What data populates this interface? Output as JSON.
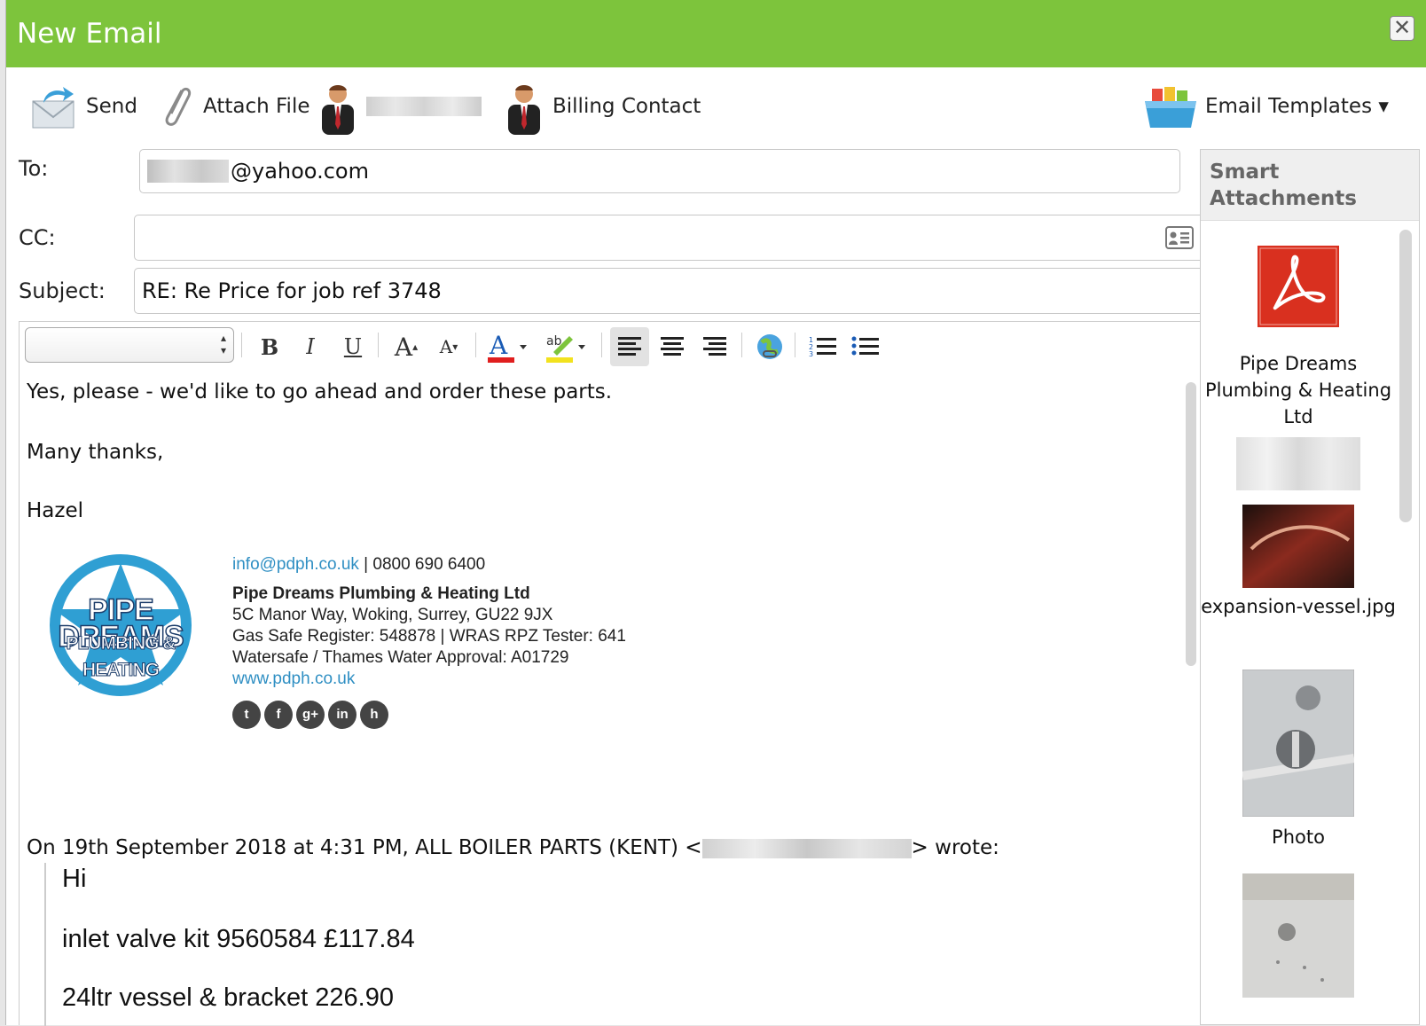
{
  "window": {
    "title": "New Email",
    "close_glyph": "✕"
  },
  "toolbar": {
    "send_label": "Send",
    "attach_label": "Attach File",
    "billing_label": "Billing Contact",
    "templates_label": "Email Templates ▾"
  },
  "fields": {
    "to_label": "To:",
    "to_value_visible": "@yahoo.com",
    "cc_label": "CC:",
    "cc_value": "",
    "subject_label": "Subject:",
    "subject_value": "RE: Re Price for job ref 3748"
  },
  "editor": {
    "line1": "Yes, please - we'd like to go ahead and order these parts.",
    "line2": "Many thanks,",
    "line3": "Hazel",
    "signature": {
      "logo_line1": "PIPE DREAMS",
      "logo_line2": "PLUMBING & HEATING",
      "email": "info@pdph.co.uk",
      "phone": " | 0800 690 6400",
      "company": "Pipe Dreams Plumbing & Heating Ltd",
      "address": "5C Manor Way, Woking, Surrey, GU22 9JX",
      "register": "Gas Safe Register: 548878 | WRAS RPZ Tester: 641",
      "approval": "Watersafe / Thames Water Approval: A01729",
      "website": "www.pdph.co.uk"
    },
    "quote_intro_start": "On 19th September 2018 at 4:31 PM, ALL BOILER PARTS (KENT) <",
    "quote_intro_end": "> wrote:",
    "quote_hi": "Hi",
    "quote_item1": "inlet valve kit 9560584 £117.84",
    "quote_item2_partial": "24ltr vessel & bracket 226.90"
  },
  "smart": {
    "heading": "Smart Attachments",
    "items": [
      {
        "label": "Pipe Dreams Plumbing & Heating Ltd",
        "icon": "pdf-icon"
      },
      {
        "label": "expansion-vessel.jpg",
        "icon": "image-thumbnail"
      },
      {
        "label": "Photo",
        "icon": "image-thumbnail"
      }
    ]
  },
  "colors": {
    "titlebar": "#7dc43c",
    "link": "#2f8fc3",
    "pdf": "#d9301f"
  }
}
